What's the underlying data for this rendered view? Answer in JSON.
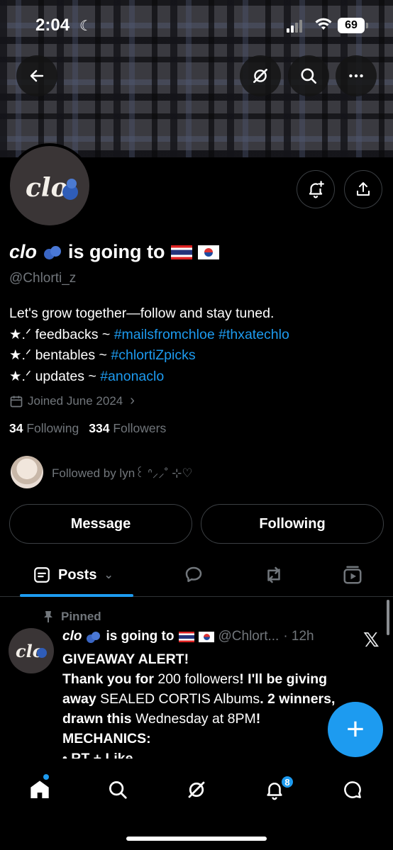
{
  "status": {
    "time": "2:04",
    "battery": "69"
  },
  "profile": {
    "name_italic": "clo",
    "name_rest": "is going to",
    "handle": "@Chlorti_z",
    "avatar_text": "clo",
    "bio_line1": "Let's grow together—follow and stay tuned.",
    "bio_line2_prefix": "★.ᐟ feedbacks ~ ",
    "bio_line2_tag1": "#mailsfromchloe",
    "bio_line2_tag2": "#thxatechlo",
    "bio_line3_prefix": "★.ᐟ bentables ~ ",
    "bio_line3_tag": "#chlortiZpicks",
    "bio_line4_prefix": "★.ᐟ updates ~ ",
    "bio_line4_tag": "#anonaclo",
    "joined": "Joined June 2024",
    "following_count": "34",
    "following_label": "Following",
    "followers_count": "334",
    "followers_label": "Followers",
    "followed_by": "Followed by lyn꒰ ᐢ⸝⸝˚ ⊹♡"
  },
  "actions": {
    "message": "Message",
    "following": "Following"
  },
  "tabs": {
    "posts": "Posts"
  },
  "post": {
    "pinned": "Pinned",
    "name_italic": "clo",
    "name_rest": "is going to",
    "handle": "@Chlort...",
    "time": "· 12h",
    "line1": "GIVEAWAY ALERT!",
    "line2a": "Thank you for ",
    "line2b": "200 followers",
    "line2c": "! I'll be giving",
    "line3a": "away ",
    "line3b": "SEALED CORTIS Albums",
    "line3c": ". 2 winners,",
    "line4a": "drawn this ",
    "line4b": "Wednesday at 8PM",
    "line4c": "!",
    "line5": "MECHANICS:",
    "line6": "• RT + Like"
  },
  "nav": {
    "notifications_badge": "8"
  },
  "colors": {
    "accent": "#1d9bf0",
    "muted": "#71767b",
    "background": "#000000"
  }
}
